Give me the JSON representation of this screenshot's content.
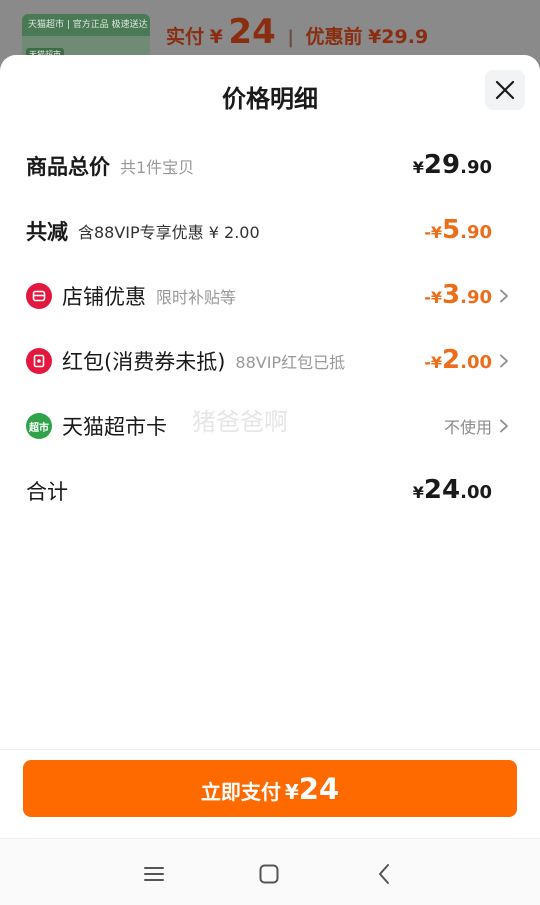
{
  "background": {
    "thumb_banner": "天猫超市 | 官方正品 极速送达",
    "thumb_tag": "天猫超市",
    "paid_label": "实付",
    "paid_currency": "¥",
    "paid_amount": "24",
    "separator": "|",
    "before_label": "优惠前",
    "before_amount": "¥29.9"
  },
  "sheet": {
    "title": "价格明细",
    "close_icon": "close-icon"
  },
  "rows": {
    "total": {
      "label": "商品总价",
      "sub": "共1件宝贝",
      "currency": "¥",
      "int": "29",
      "dec": ".90"
    },
    "reduced": {
      "label": "共减",
      "sub": "含88VIP专享优惠 ¥ 2.00",
      "prefix": "-¥",
      "int": "5",
      "dec": ".90"
    },
    "store": {
      "label": "店铺优惠",
      "sub": "限时补贴等",
      "prefix": "-¥",
      "int": "3",
      "dec": ".90",
      "icon": "store-icon"
    },
    "redpack": {
      "label": "红包(消费券未抵)",
      "sub": "88VIP红包已抵",
      "prefix": "-¥",
      "int": "2",
      "dec": ".00",
      "icon": "red-envelope-icon"
    },
    "card": {
      "label": "天猫超市卡",
      "value": "不使用",
      "icon_text": "超市",
      "icon": "supermarket-card-icon"
    },
    "sum": {
      "label": "合计",
      "currency": "¥",
      "int": "24",
      "dec": ".00"
    }
  },
  "watermark": "猪爸爸啊",
  "pay_button": {
    "label": "立即支付",
    "currency": "¥",
    "amount": "24"
  },
  "colors": {
    "accent": "#ff6a00",
    "discount": "#ec6d1a",
    "store_icon": "#e4173f",
    "card_icon": "#2fa24a"
  },
  "navbar": {
    "icons": [
      "menu-icon",
      "home-square-icon",
      "back-icon"
    ]
  }
}
